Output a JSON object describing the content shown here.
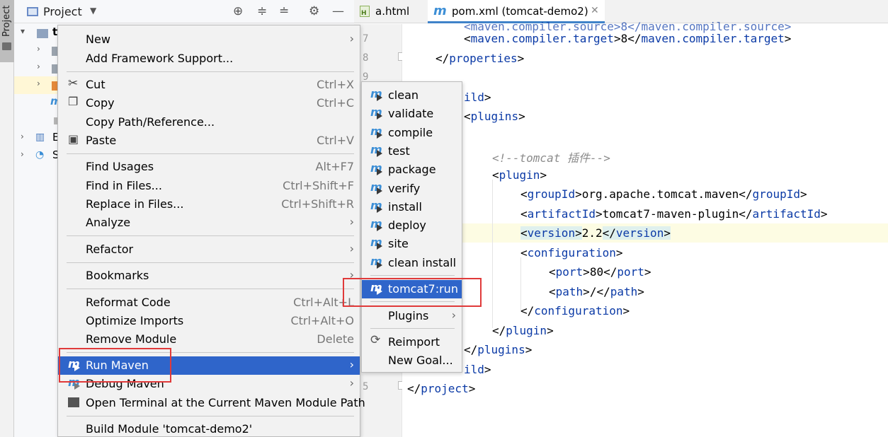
{
  "toolstrip": {
    "project_tab_label": "Project"
  },
  "project_panel": {
    "title": "Project",
    "header_icons": [
      "crosshair-icon",
      "expand-all-icon",
      "collapse-all-icon",
      "gear-icon",
      "minimize-icon"
    ],
    "tree_rows": [
      {
        "label": "t",
        "expanded": true
      },
      {
        "label": ""
      },
      {
        "label": ""
      },
      {
        "label": ""
      },
      {
        "label": ""
      },
      {
        "label": ""
      },
      {
        "label": "E"
      },
      {
        "label": "S"
      }
    ]
  },
  "editor": {
    "tabs": [
      {
        "label": "a.html",
        "active": false,
        "icon": "html-file-icon"
      },
      {
        "label": "pom.xml (tomcat-demo2)",
        "active": true,
        "icon": "maven-file-icon"
      }
    ],
    "line_numbers": [
      "7",
      "8",
      "9",
      "5"
    ],
    "code": {
      "l1_tag": "maven.compiler.target",
      "l1_value": "8",
      "l2_tag": "properties",
      "l3_tag": "ild",
      "l4_tag": "plugins",
      "l5_comment": "<!--tomcat 插件-->",
      "l6_tag": "plugin",
      "l7_tag": "groupId",
      "l7_value": "org.apache.tomcat.maven",
      "l8_tag": "artifactId",
      "l8_value": "tomcat7-maven-plugin",
      "l9_tag": "version",
      "l9_value": "2.2",
      "l10_tag": "configuration",
      "l11_tag": "port",
      "l11_value": "80",
      "l12_tag": "path",
      "l12_value": "/",
      "l13_tag": "configuration",
      "l14_tag": "plugin",
      "l15_tag": "plugins",
      "l16_tag": "ild",
      "l17_tag": "project"
    }
  },
  "context_menu": {
    "items": [
      {
        "label": "New",
        "submenu": true
      },
      {
        "label": "Add Framework Support..."
      },
      {
        "label": "Cut",
        "shortcut": "Ctrl+X",
        "icon": "scissors-icon"
      },
      {
        "label": "Copy",
        "shortcut": "Ctrl+C",
        "icon": "copy-icon"
      },
      {
        "label": "Copy Path/Reference..."
      },
      {
        "label": "Paste",
        "shortcut": "Ctrl+V",
        "icon": "clipboard-icon"
      },
      {
        "label": "Find Usages",
        "shortcut": "Alt+F7"
      },
      {
        "label": "Find in Files...",
        "shortcut": "Ctrl+Shift+F"
      },
      {
        "label": "Replace in Files...",
        "shortcut": "Ctrl+Shift+R"
      },
      {
        "label": "Analyze",
        "submenu": true
      },
      {
        "label": "Refactor",
        "submenu": true
      },
      {
        "label": "Bookmarks",
        "submenu": true
      },
      {
        "label": "Reformat Code",
        "shortcut": "Ctrl+Alt+L"
      },
      {
        "label": "Optimize Imports",
        "shortcut": "Ctrl+Alt+O"
      },
      {
        "label": "Remove Module",
        "shortcut": "Delete"
      },
      {
        "label": "Run Maven",
        "submenu": true,
        "selected": true,
        "icon": "maven-run-icon"
      },
      {
        "label": "Debug Maven",
        "submenu": true,
        "icon": "maven-debug-icon"
      },
      {
        "label": "Open Terminal at the Current Maven Module Path",
        "icon": "terminal-icon"
      },
      {
        "label": "Build Module 'tomcat-demo2'"
      }
    ]
  },
  "run_maven_submenu": {
    "items": [
      {
        "label": "clean"
      },
      {
        "label": "validate"
      },
      {
        "label": "compile"
      },
      {
        "label": "test"
      },
      {
        "label": "package"
      },
      {
        "label": "verify"
      },
      {
        "label": "install"
      },
      {
        "label": "deploy"
      },
      {
        "label": "site"
      },
      {
        "label": "clean install"
      },
      {
        "label": "tomcat7:run",
        "selected": true
      },
      {
        "label": "Plugins",
        "submenu": true
      },
      {
        "label": "Reimport",
        "icon": "refresh-icon"
      },
      {
        "label": "New Goal..."
      }
    ]
  },
  "colors": {
    "selection": "#2f65ca",
    "xml_tag": "#0b3aa6",
    "annotation_red": "#e03a3a",
    "maven_blue": "#3d8fd6"
  }
}
